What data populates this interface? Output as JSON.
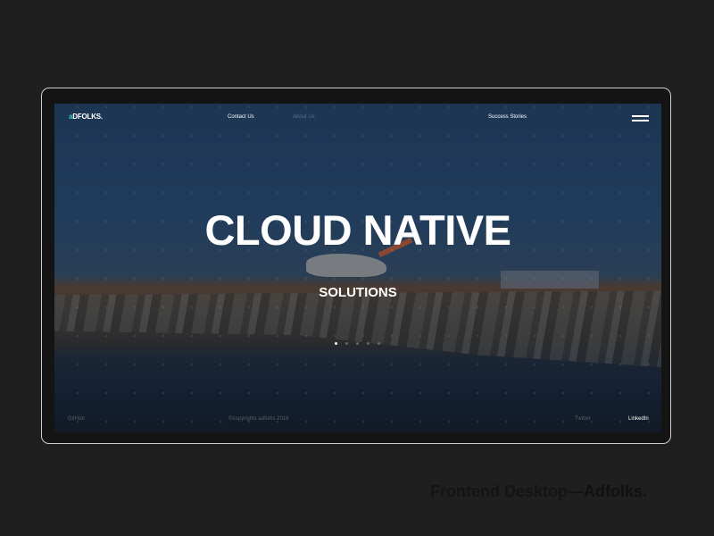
{
  "logo": {
    "accent": "a",
    "rest": "DFOLKS."
  },
  "nav": {
    "contact": "Contact Us",
    "about": "About Us",
    "success": "Success Stories"
  },
  "hero": {
    "title": "CLOUD NATIVE",
    "subtitle": "SOLUTIONS",
    "slides": 5,
    "active_slide": 1
  },
  "footer": {
    "github": "GitHub",
    "copyright": "©copyrights adfolks 2018",
    "twitter": "Twitter",
    "linkedin": "LinkedIn"
  },
  "caption": {
    "prefix": "Frontend Desktop—",
    "brand": "Adfolks."
  },
  "colors": {
    "accent": "#2fd3b0",
    "background": "#1f1f1f"
  }
}
